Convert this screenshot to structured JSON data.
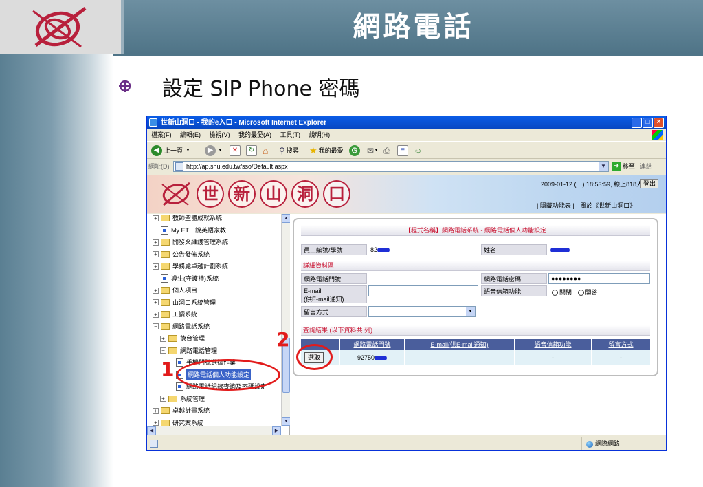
{
  "slide": {
    "title": "網路電話",
    "bullet": "設定 SIP Phone 密碼"
  },
  "colors": {
    "header_bg": "#5a7f92",
    "annotation_red": "#e21b1b",
    "ie_titlebar": "#0a5ce6",
    "program_title_red": "#c8102e",
    "results_header": "#4a5e9c"
  },
  "browser": {
    "title": "世新山洞口 - 我的e入口 - Microsoft Internet Explorer",
    "menu": [
      "檔案(F)",
      "編輯(E)",
      "檢視(V)",
      "我的最愛(A)",
      "工具(T)",
      "說明(H)"
    ],
    "toolbar": {
      "back": "上一頁",
      "search": "搜尋",
      "favorites": "我的最愛"
    },
    "address_label": "網址(D)",
    "url": "http://ap.shu.edu.tw/sso/Default.aspx",
    "go_label": "移至",
    "links_label": "連結",
    "status_zone": "網際網路",
    "window_buttons": [
      "minimize-icon",
      "maximize-icon",
      "close-icon"
    ]
  },
  "portal": {
    "banner_chars": [
      "世",
      "新",
      "山",
      "洞",
      "口"
    ],
    "datetime": "2009-01-12 (一) 18:53:59, 線上818人",
    "logout": "登出",
    "links": [
      "| 隱藏功能表 |",
      "關於《世新山洞口》"
    ]
  },
  "tree": [
    {
      "label": "教師聖體成就系統",
      "type": "folder",
      "expanded": false,
      "level": 0
    },
    {
      "label": "My ET口說英語家教",
      "type": "doc",
      "level": 0
    },
    {
      "label": "開發與維護管理系統",
      "type": "folder",
      "expanded": false,
      "level": 0
    },
    {
      "label": "公告發佈系統",
      "type": "folder",
      "expanded": false,
      "level": 0
    },
    {
      "label": "學務處卓越計劃系統",
      "type": "folder",
      "expanded": false,
      "level": 0
    },
    {
      "label": "導生(守護神)系統",
      "type": "doc",
      "level": 0
    },
    {
      "label": "個人項目",
      "type": "folder",
      "expanded": false,
      "level": 0
    },
    {
      "label": "山洞口系統管理",
      "type": "folder",
      "expanded": false,
      "level": 0
    },
    {
      "label": "工讀系統",
      "type": "folder",
      "expanded": false,
      "level": 0
    },
    {
      "label": "網路電話系統",
      "type": "folder",
      "expanded": true,
      "level": 0
    },
    {
      "label": "後台管理",
      "type": "folder",
      "expanded": false,
      "level": 1
    },
    {
      "label": "網路電話管理",
      "type": "folder",
      "expanded": true,
      "level": 1
    },
    {
      "label": "手機門號選擇作業",
      "type": "doc",
      "level": 2
    },
    {
      "label": "網路電話個人功能設定",
      "type": "doc",
      "level": 2,
      "selected": true
    },
    {
      "label": "網路電話紀錄查詢及密碼設定",
      "type": "doc",
      "level": 2
    },
    {
      "label": "系統管理",
      "type": "folder",
      "expanded": false,
      "level": 1
    },
    {
      "label": "卓越計畫系統",
      "type": "folder",
      "expanded": false,
      "level": 0
    },
    {
      "label": "研究案系統",
      "type": "folder",
      "expanded": false,
      "level": 0
    }
  ],
  "form": {
    "program_title": "【程式名稱】網路電話系統 - 網路電話個人功能設定",
    "emp_label": "員工編號/學號",
    "emp_value": "82",
    "name_label": "姓名",
    "detail_section": "詳細資料區",
    "phone_label": "網路電話門號",
    "password_label": "網路電話密碼",
    "password_value": "●●●●●●●●",
    "email_label": "E-mail",
    "email_note": "(供E-mail通知)",
    "voicemail_label": "語音信箱功能",
    "radio_off": "關閉",
    "radio_on": "開啓",
    "message_label": "留言方式",
    "results_title": "查詢結果 (以下資料共 列)",
    "results_columns": [
      "網路電話門號",
      "E-mail(供E-mail通知)",
      "語音信箱功能",
      "留言方式"
    ],
    "results_rows": [
      {
        "select": "選取",
        "phone": "92750",
        "email": "",
        "voicemail": "-",
        "message": "-"
      }
    ]
  },
  "annotations": {
    "step1": "1",
    "step2": "2"
  }
}
